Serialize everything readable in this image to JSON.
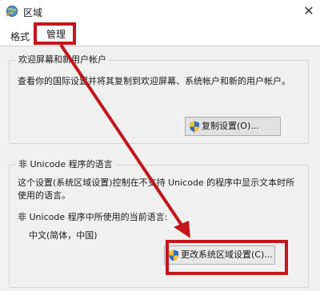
{
  "window": {
    "title": "区域",
    "close_symbol": "✕"
  },
  "tabs": [
    {
      "label": "格式"
    },
    {
      "label": "管理"
    }
  ],
  "welcome": {
    "title": "欢迎屏幕和新用户帐户",
    "description": "查看你的国际设置并将其复制到欢迎屏幕、系统帐户和新的用户帐户。",
    "copy_button": "复制设置(O)..."
  },
  "non_unicode": {
    "title": "非 Unicode 程序的语言",
    "description": "这个设置(系统区域设置)控制在不支持 Unicode 的程序中显示文本时所使用的语言。",
    "current_label": "非 Unicode 程序中所使用的当前语言:",
    "current_value": "中文(简体，中国)",
    "change_button": "更改系统区域设置(C)..."
  },
  "colors": {
    "highlight": "#c4161c",
    "panel_bg": "#f0f0f0"
  },
  "icons": {
    "app": "region-globe-icon",
    "shield": "uac-shield-icon"
  }
}
